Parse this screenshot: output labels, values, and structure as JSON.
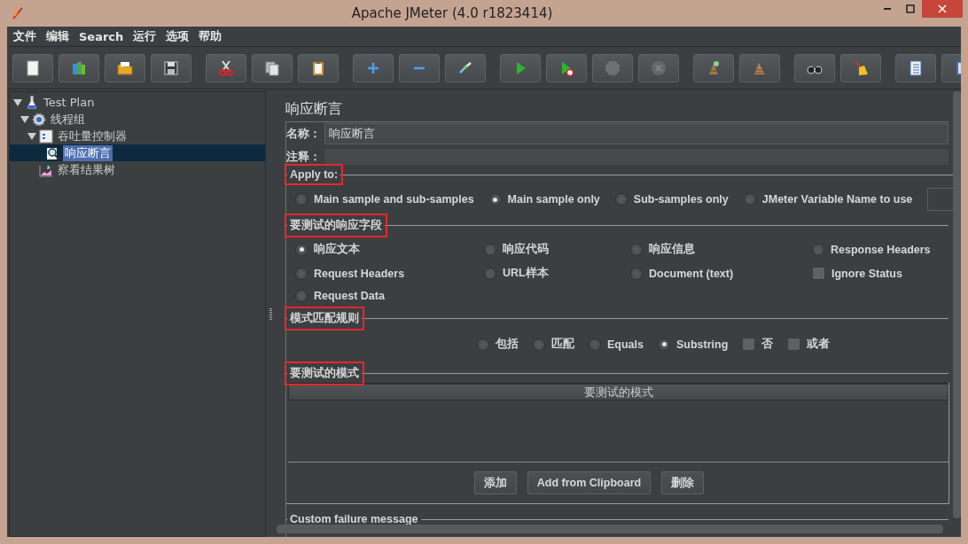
{
  "window": {
    "title": "Apache JMeter (4.0 r1823414)"
  },
  "menu": [
    "文件",
    "编辑",
    "Search",
    "运行",
    "选项",
    "帮助"
  ],
  "toolbar": [
    {
      "kind": "new",
      "disabled": false
    },
    {
      "kind": "templates",
      "disabled": false
    },
    {
      "kind": "open",
      "disabled": false
    },
    {
      "kind": "save",
      "disabled": false
    },
    {
      "kind": "cut",
      "disabled": false
    },
    {
      "kind": "copy",
      "disabled": false
    },
    {
      "kind": "paste",
      "disabled": false
    },
    {
      "kind": "expand",
      "disabled": false
    },
    {
      "kind": "collapse",
      "disabled": false
    },
    {
      "kind": "toggle",
      "disabled": false
    },
    {
      "kind": "start",
      "disabled": false
    },
    {
      "kind": "start-no-pauses",
      "disabled": false
    },
    {
      "kind": "stop",
      "disabled": true
    },
    {
      "kind": "shutdown",
      "disabled": true
    },
    {
      "kind": "clear",
      "disabled": false
    },
    {
      "kind": "clear-all",
      "disabled": false
    },
    {
      "kind": "search",
      "disabled": false
    },
    {
      "kind": "reset-search",
      "disabled": false
    },
    {
      "kind": "function-helper",
      "disabled": false
    },
    {
      "kind": "log",
      "disabled": false
    }
  ],
  "tree": [
    {
      "label": "Test Plan",
      "kind": "test-plan",
      "expanded": true,
      "selected": false,
      "children": [
        {
          "label": "线程组",
          "kind": "thread-group",
          "expanded": true,
          "selected": false,
          "children": [
            {
              "label": "吞吐量控制器",
              "kind": "controller",
              "expanded": true,
              "selected": false,
              "children": [
                {
                  "label": "响应断言",
                  "kind": "assertion",
                  "selected": true
                }
              ]
            },
            {
              "label": "察看结果树",
              "kind": "listener",
              "selected": false
            }
          ]
        }
      ]
    }
  ],
  "editor": {
    "title": "响应断言",
    "name_label": "名称：",
    "name_value": "响应断言",
    "comment_label": "注释：",
    "apply_to": {
      "title": "Apply to:",
      "annotated": true,
      "options": [
        {
          "label": "Main sample and sub-samples",
          "selected": false
        },
        {
          "label": "Main sample only",
          "selected": true
        },
        {
          "label": "Sub-samples only",
          "selected": false
        },
        {
          "label": "JMeter Variable Name to use",
          "selected": false
        }
      ]
    },
    "response_field": {
      "title": "要测试的响应字段",
      "annotated": true,
      "options": [
        {
          "label": "响应文本",
          "kind": "radio",
          "selected": true
        },
        {
          "label": "响应代码",
          "kind": "radio",
          "selected": false
        },
        {
          "label": "响应信息",
          "kind": "radio",
          "selected": false
        },
        {
          "label": "Response Headers",
          "kind": "radio",
          "selected": false
        },
        {
          "label": "Request Headers",
          "kind": "radio",
          "selected": false
        },
        {
          "label": "URL样本",
          "kind": "radio",
          "selected": false
        },
        {
          "label": "Document (text)",
          "kind": "radio",
          "selected": false
        },
        {
          "label": "Ignore Status",
          "kind": "checkbox",
          "checked": false
        },
        {
          "label": "Request Data",
          "kind": "radio",
          "selected": false
        }
      ]
    },
    "pattern_rules": {
      "title": "模式匹配规则",
      "annotated": true,
      "options": [
        {
          "label": "包括",
          "kind": "radio",
          "selected": false
        },
        {
          "label": "匹配",
          "kind": "radio",
          "selected": false
        },
        {
          "label": "Equals",
          "kind": "radio",
          "selected": false
        },
        {
          "label": "Substring",
          "kind": "radio",
          "selected": true
        },
        {
          "label": "否",
          "kind": "checkbox",
          "checked": false
        },
        {
          "label": "或者",
          "kind": "checkbox",
          "checked": false
        }
      ]
    },
    "patterns": {
      "title": "要测试的模式",
      "annotated": true,
      "column": "要测试的模式",
      "buttons": [
        "添加",
        "Add from Clipboard",
        "删除"
      ]
    },
    "custom_failure": {
      "title": "Custom failure message"
    }
  }
}
